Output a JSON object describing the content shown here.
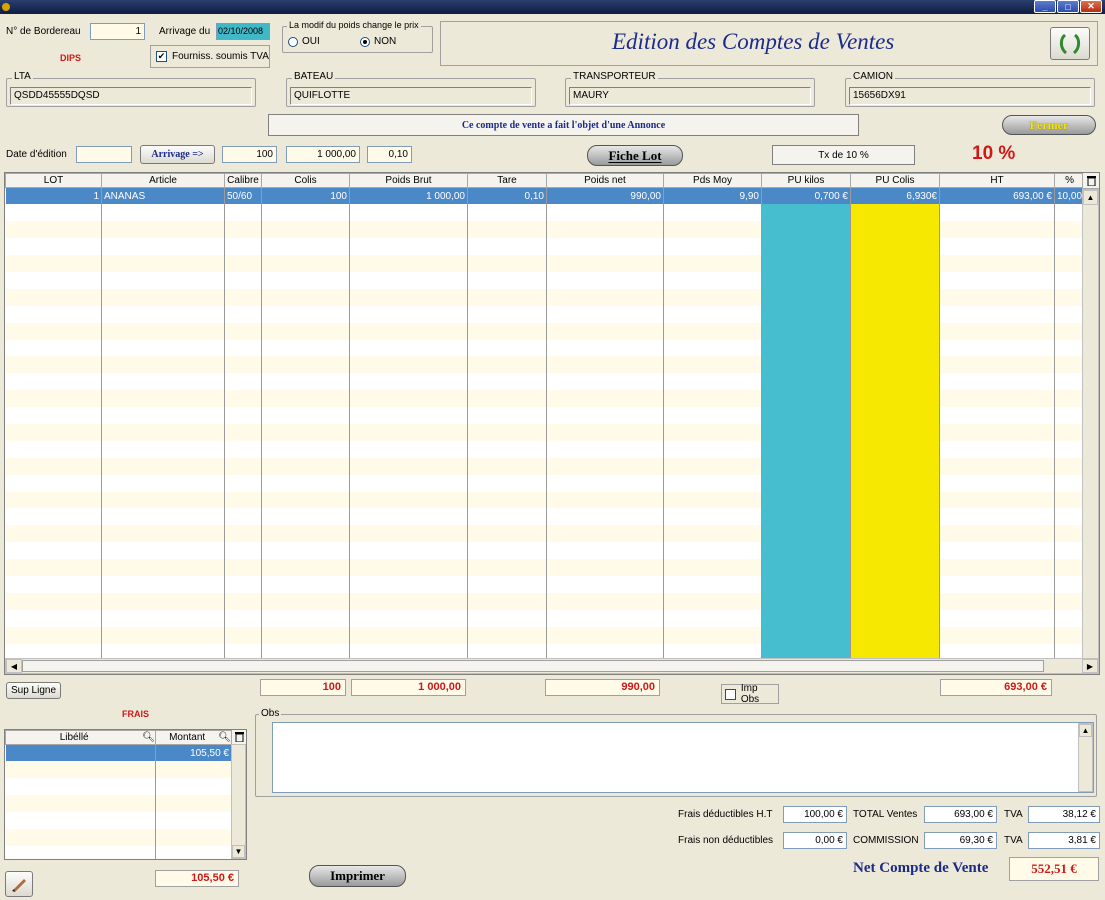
{
  "header": {
    "bordereau_label": "N° de Bordereau",
    "bordereau_value": "1",
    "client_code": "DIPS",
    "arrivage_label": "Arrivage du",
    "arrivage_date": "02/10/2008",
    "tva_checkbox_label": "Fourniss. soumis TVA",
    "tva_checked": "✔",
    "poids_group_label": "La modif du poids change le prix",
    "radio_oui": "OUI",
    "radio_non": "NON",
    "title": "Edition des Comptes de Ventes"
  },
  "fields": {
    "lta_label": "LTA",
    "lta_value": "QSDD45555DQSD",
    "bateau_label": "BATEAU",
    "bateau_value": "QUIFLOTTE",
    "transporteur_label": "TRANSPORTEUR",
    "transporteur_value": "MAURY",
    "camion_label": "CAMION",
    "camion_value": "15656DX91"
  },
  "annonce_text": "Ce compte de vente a fait l'objet d'une Annonce",
  "fermer_label": "Fermer",
  "edition": {
    "date_label": "Date d'édition",
    "date_value": "",
    "arrivage_button": "Arrivage =>",
    "colis": "100",
    "poids": "1 000,00",
    "tare": "0,10",
    "fiche_lot": "Fiche Lot",
    "tx_text": "Tx de 10 %",
    "percent": "10 %"
  },
  "grid": {
    "headers": [
      "LOT",
      "Article",
      "Calibre",
      "Colis",
      "Poids Brut",
      "Tare",
      "Poids net",
      "Pds Moy",
      "PU kilos",
      "PU Colis",
      "HT",
      "%"
    ],
    "rows": [
      [
        "1",
        "ANANAS",
        "50/60",
        "100",
        "1 000,00",
        "0,10",
        "990,00",
        "9,90",
        "0,700 €",
        "6,930€",
        "693,00 €",
        "10,00"
      ]
    ]
  },
  "totals": {
    "sup_ligne": "Sup Ligne",
    "colis": "100",
    "poids_brut": "1 000,00",
    "poids_net": "990,00",
    "imp_obs": "Imp Obs",
    "ht": "693,00 €"
  },
  "frais": {
    "title": "FRAIS",
    "headers": [
      "Libéllé",
      "Montant"
    ],
    "rows": [
      [
        "",
        "105,50 €"
      ]
    ],
    "total": "105,50 €"
  },
  "obs": {
    "label": "Obs",
    "text": ""
  },
  "summary": {
    "frais_deduct_label": "Frais déductibles H.T",
    "frais_deduct_value": "100,00 €",
    "frais_non_label": "Frais non déductibles",
    "frais_non_value": "0,00 €",
    "total_ventes_label": "TOTAL Ventes",
    "total_ventes_value": "693,00 €",
    "commission_label": "COMMISSION",
    "commission_value": "69,30 €",
    "tva_label": "TVA",
    "tva1_value": "38,12 €",
    "tva2_value": "3,81 €",
    "net_label": "Net Compte de Vente",
    "net_value": "552,51 €"
  },
  "imprimer_label": "Imprimer"
}
